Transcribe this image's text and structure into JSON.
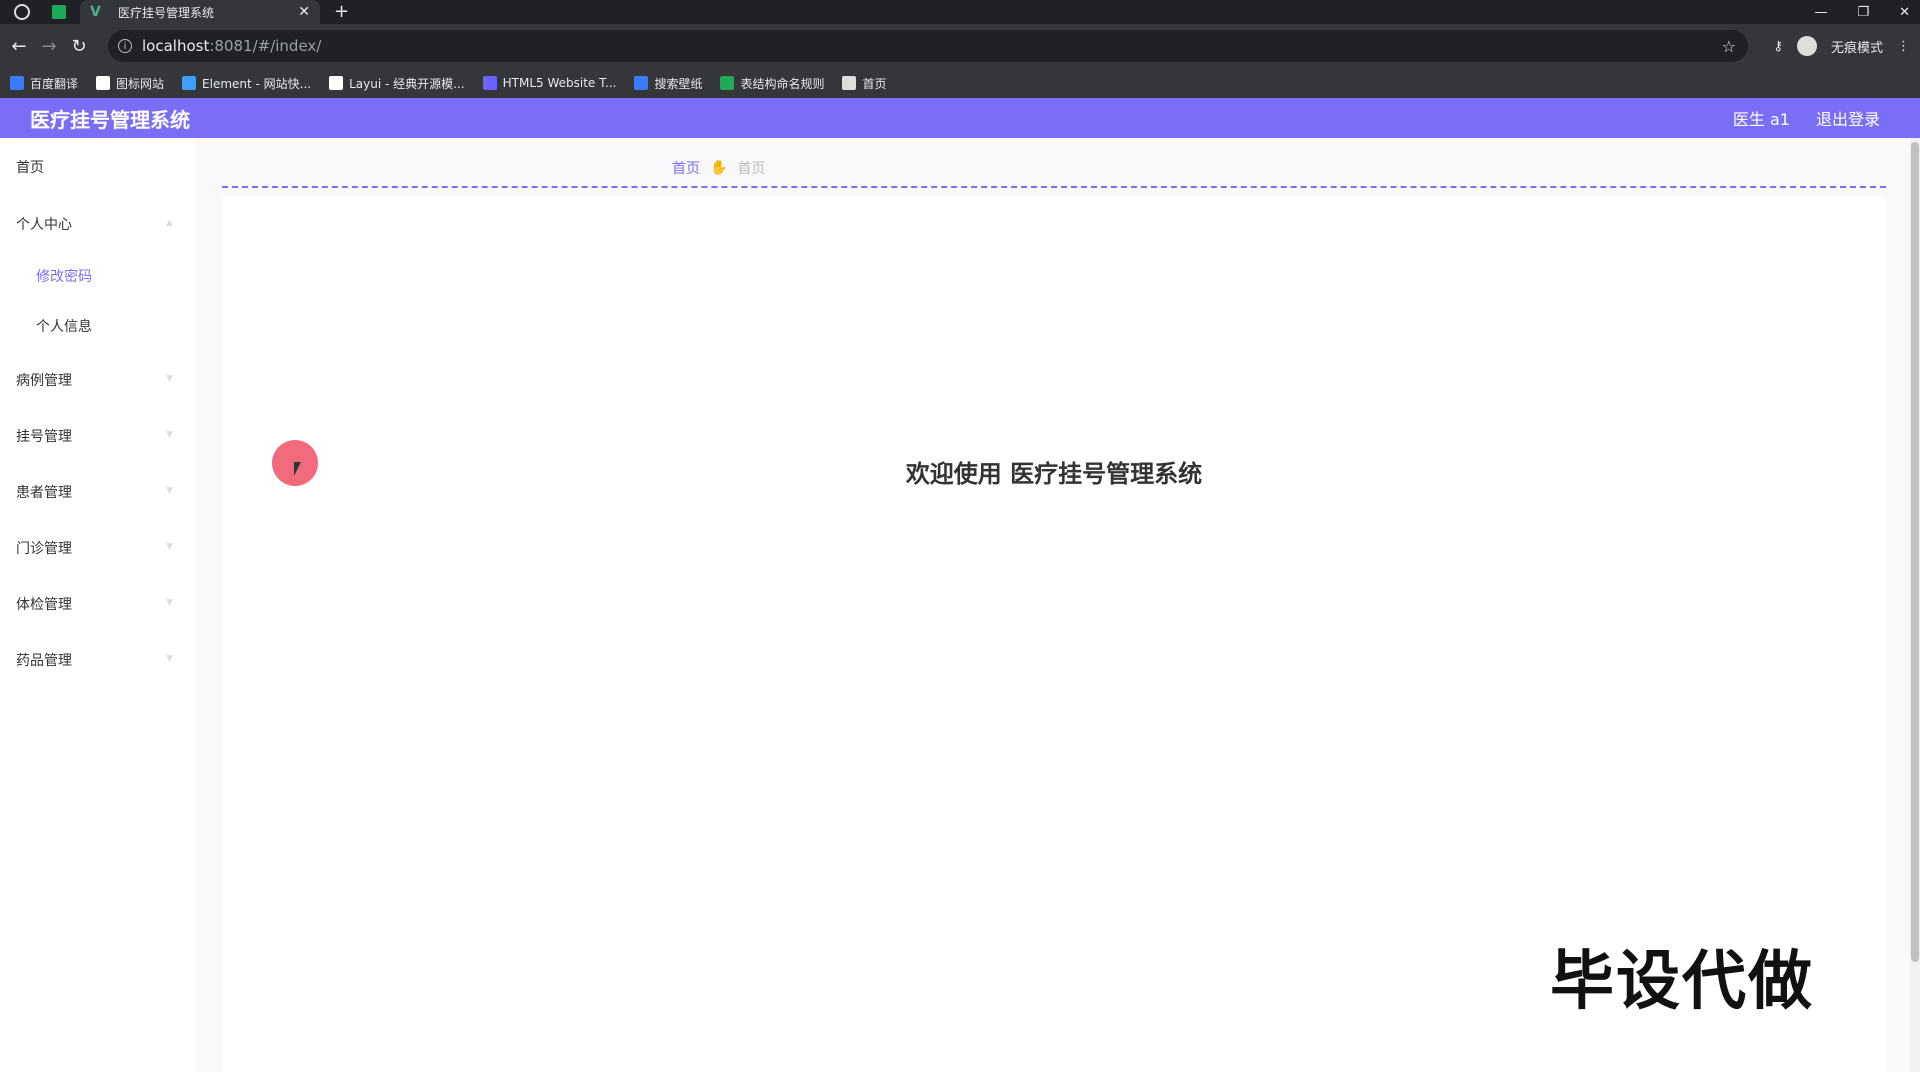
{
  "browser": {
    "tab_title": "医疗挂号管理系统",
    "tab_close": "✕",
    "new_tab": "+",
    "url_host": "localhost",
    "url_rest": ":8081/#/index/",
    "incognito_label": "无痕模式",
    "bookmarks": [
      {
        "label": "百度翻译",
        "color": "#3b7cff"
      },
      {
        "label": "图标网站",
        "color": "#ffffff"
      },
      {
        "label": "Element - 网站快...",
        "color": "#409eff"
      },
      {
        "label": "Layui - 经典开源模...",
        "color": "#ffffff"
      },
      {
        "label": "HTML5 Website T...",
        "color": "#6c63ff"
      },
      {
        "label": "搜索壁纸",
        "color": "#3b7cff"
      },
      {
        "label": "表结构命名规则",
        "color": "#1faa59"
      },
      {
        "label": "首页",
        "color": "#dddddd"
      }
    ]
  },
  "header": {
    "title": "医疗挂号管理系统",
    "user": "医生 a1",
    "logout": "退出登录"
  },
  "sidebar": {
    "items": [
      {
        "label": "首页"
      },
      {
        "label": "个人中心"
      },
      {
        "label": "病例管理"
      },
      {
        "label": "挂号管理"
      },
      {
        "label": "患者管理"
      },
      {
        "label": "门诊管理"
      },
      {
        "label": "体检管理"
      },
      {
        "label": "药品管理"
      }
    ],
    "sub_items": [
      {
        "label": "修改密码",
        "active": true
      },
      {
        "label": "个人信息",
        "active": false
      }
    ]
  },
  "breadcrumb": {
    "home": "首页",
    "current": "首页"
  },
  "main": {
    "welcome": "欢迎使用 医疗挂号管理系统"
  },
  "watermark": "毕设代做",
  "colors": {
    "accent": "#7b6ef6",
    "cursor_highlight": "#f16b7d"
  }
}
